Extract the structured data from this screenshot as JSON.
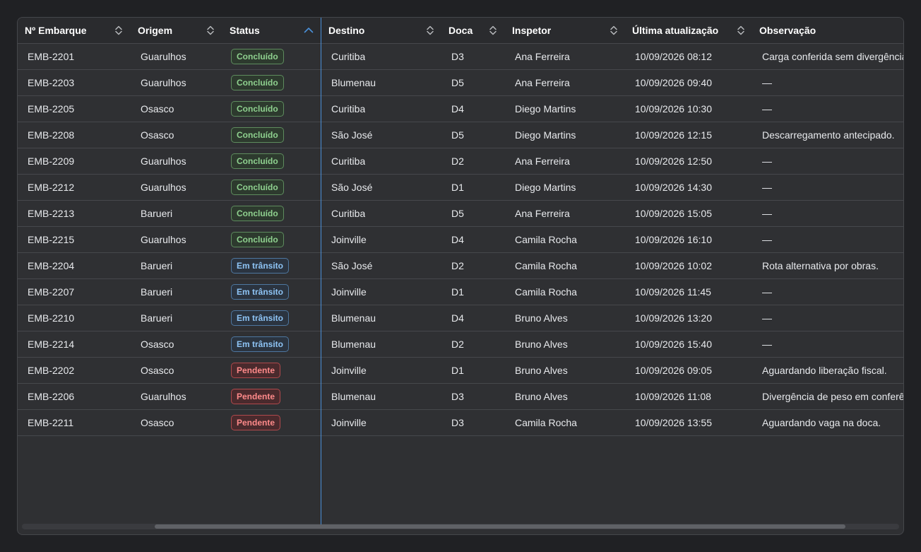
{
  "columns": [
    {
      "label": "Nº Embarque",
      "sort": "none"
    },
    {
      "label": "Origem",
      "sort": "none"
    },
    {
      "label": "Status",
      "sort": "asc"
    },
    {
      "label": "Destino",
      "sort": "none"
    },
    {
      "label": "Doca",
      "sort": "none"
    },
    {
      "label": "Inspetor",
      "sort": "none"
    },
    {
      "label": "Última atualização",
      "sort": "none"
    },
    {
      "label": "Observação",
      "sort": "none"
    }
  ],
  "rows": [
    {
      "id": "EMB-2201",
      "origem": "Guarulhos",
      "status": "Concluído",
      "status_type": "done",
      "destino": "Curitiba",
      "doca": "D3",
      "inspetor": "Ana Ferreira",
      "atualizacao": "10/09/2026 08:12",
      "observacao": "Carga conferida sem divergência"
    },
    {
      "id": "EMB-2203",
      "origem": "Guarulhos",
      "status": "Concluído",
      "status_type": "done",
      "destino": "Blumenau",
      "doca": "D5",
      "inspetor": "Ana Ferreira",
      "atualizacao": "10/09/2026 09:40",
      "observacao": "—"
    },
    {
      "id": "EMB-2205",
      "origem": "Osasco",
      "status": "Concluído",
      "status_type": "done",
      "destino": "Curitiba",
      "doca": "D4",
      "inspetor": "Diego Martins",
      "atualizacao": "10/09/2026 10:30",
      "observacao": "—"
    },
    {
      "id": "EMB-2208",
      "origem": "Osasco",
      "status": "Concluído",
      "status_type": "done",
      "destino": "São José",
      "doca": "D5",
      "inspetor": "Diego Martins",
      "atualizacao": "10/09/2026 12:15",
      "observacao": "Descarregamento antecipado."
    },
    {
      "id": "EMB-2209",
      "origem": "Guarulhos",
      "status": "Concluído",
      "status_type": "done",
      "destino": "Curitiba",
      "doca": "D2",
      "inspetor": "Ana Ferreira",
      "atualizacao": "10/09/2026 12:50",
      "observacao": "—"
    },
    {
      "id": "EMB-2212",
      "origem": "Guarulhos",
      "status": "Concluído",
      "status_type": "done",
      "destino": "São José",
      "doca": "D1",
      "inspetor": "Diego Martins",
      "atualizacao": "10/09/2026 14:30",
      "observacao": "—"
    },
    {
      "id": "EMB-2213",
      "origem": "Barueri",
      "status": "Concluído",
      "status_type": "done",
      "destino": "Curitiba",
      "doca": "D5",
      "inspetor": "Ana Ferreira",
      "atualizacao": "10/09/2026 15:05",
      "observacao": "—"
    },
    {
      "id": "EMB-2215",
      "origem": "Guarulhos",
      "status": "Concluído",
      "status_type": "done",
      "destino": "Joinville",
      "doca": "D4",
      "inspetor": "Camila Rocha",
      "atualizacao": "10/09/2026 16:10",
      "observacao": "—"
    },
    {
      "id": "EMB-2204",
      "origem": "Barueri",
      "status": "Em trânsito",
      "status_type": "transit",
      "destino": "São José",
      "doca": "D2",
      "inspetor": "Camila Rocha",
      "atualizacao": "10/09/2026 10:02",
      "observacao": "Rota alternativa por obras."
    },
    {
      "id": "EMB-2207",
      "origem": "Barueri",
      "status": "Em trânsito",
      "status_type": "transit",
      "destino": "Joinville",
      "doca": "D1",
      "inspetor": "Camila Rocha",
      "atualizacao": "10/09/2026 11:45",
      "observacao": "—"
    },
    {
      "id": "EMB-2210",
      "origem": "Barueri",
      "status": "Em trânsito",
      "status_type": "transit",
      "destino": "Blumenau",
      "doca": "D4",
      "inspetor": "Bruno Alves",
      "atualizacao": "10/09/2026 13:20",
      "observacao": "—"
    },
    {
      "id": "EMB-2214",
      "origem": "Osasco",
      "status": "Em trânsito",
      "status_type": "transit",
      "destino": "Blumenau",
      "doca": "D2",
      "inspetor": "Bruno Alves",
      "atualizacao": "10/09/2026 15:40",
      "observacao": "—"
    },
    {
      "id": "EMB-2202",
      "origem": "Osasco",
      "status": "Pendente",
      "status_type": "pending",
      "destino": "Joinville",
      "doca": "D1",
      "inspetor": "Bruno Alves",
      "atualizacao": "10/09/2026 09:05",
      "observacao": "Aguardando liberação fiscal."
    },
    {
      "id": "EMB-2206",
      "origem": "Guarulhos",
      "status": "Pendente",
      "status_type": "pending",
      "destino": "Blumenau",
      "doca": "D3",
      "inspetor": "Bruno Alves",
      "atualizacao": "10/09/2026 11:08",
      "observacao": "Divergência de peso em conferê"
    },
    {
      "id": "EMB-2211",
      "origem": "Osasco",
      "status": "Pendente",
      "status_type": "pending",
      "destino": "Joinville",
      "doca": "D3",
      "inspetor": "Camila Rocha",
      "atualizacao": "10/09/2026 13:55",
      "observacao": "Aguardando vaga na doca."
    }
  ],
  "colors": {
    "background": "#202124",
    "grid": "#2f3033",
    "accent": "#4a90d9",
    "done": "#8fd18f",
    "transit": "#8ec4f5",
    "pending": "#ff8a8a"
  }
}
